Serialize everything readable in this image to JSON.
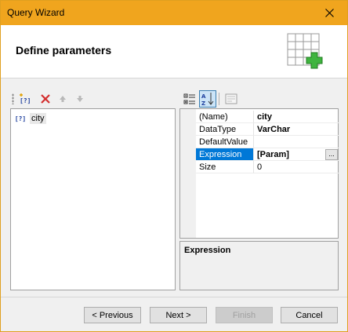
{
  "window": {
    "title": "Query Wizard"
  },
  "header": {
    "heading": "Define parameters",
    "icon": "table-add-icon"
  },
  "left_toolbar": {
    "buttons": [
      {
        "icon": "add-parameter-icon",
        "enabled": true
      },
      {
        "icon": "delete-icon",
        "enabled": true
      },
      {
        "icon": "move-up-icon",
        "enabled": false
      },
      {
        "icon": "move-down-icon",
        "enabled": false
      }
    ]
  },
  "parameters": {
    "items": [
      {
        "label": "city",
        "icon_text": "[?]"
      }
    ]
  },
  "property_toolbar": {
    "buttons": [
      {
        "icon": "categorized-icon",
        "active": false
      },
      {
        "icon": "alphabetical-sort-icon",
        "active": true
      },
      {
        "icon": "property-pages-icon",
        "active": false
      }
    ]
  },
  "properties": {
    "rows": [
      {
        "name": "(Name)",
        "value": "city",
        "bold": true,
        "selected": false
      },
      {
        "name": "DataType",
        "value": "VarChar",
        "bold": true,
        "selected": false
      },
      {
        "name": "DefaultValue",
        "value": "",
        "bold": false,
        "selected": false
      },
      {
        "name": "Expression",
        "value": "[Param]",
        "bold": true,
        "selected": true,
        "has_ellipsis": true
      },
      {
        "name": "Size",
        "value": "0",
        "bold": false,
        "selected": false
      }
    ],
    "ellipsis_label": "..."
  },
  "description": {
    "title": "Expression"
  },
  "footer": {
    "previous": "< Previous",
    "next": "Next >",
    "finish": "Finish",
    "cancel": "Cancel"
  },
  "colors": {
    "titlebar": "#f0a51e",
    "selection": "#0078d7",
    "delete": "#d32f2f",
    "add_green": "#3fb43f"
  }
}
